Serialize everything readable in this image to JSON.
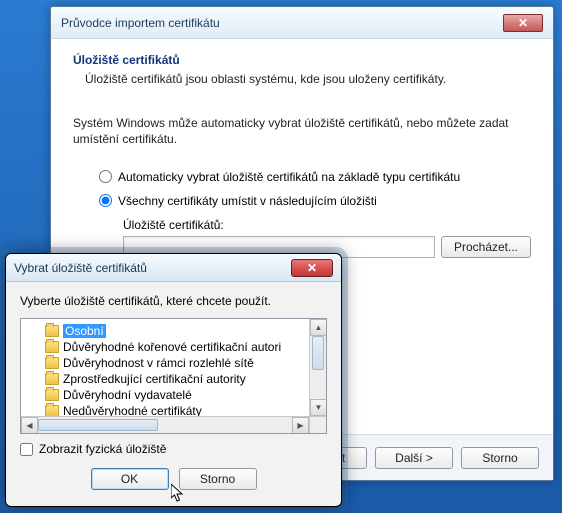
{
  "wizard": {
    "title": "Průvodce importem certifikátu",
    "section_title": "Úložiště certifikátů",
    "section_sub": "Úložiště certifikátů jsou oblasti systému, kde jsou uloženy certifikáty.",
    "instruction": "Systém Windows může automaticky vybrat úložiště certifikátů, nebo můžete zadat umístění certifikátu.",
    "radio_auto": "Automaticky vybrat úložiště certifikátů na základě typu certifikátu",
    "radio_manual": "Všechny certifikáty umístit v následujícím úložišti",
    "field_label": "Úložiště certifikátů:",
    "field_value": "",
    "browse": "Procházet...",
    "back": "< Zpět",
    "next": "Další >",
    "cancel": "Storno"
  },
  "dialog": {
    "title": "Vybrat úložiště certifikátů",
    "instruction": "Vyberte úložiště certifikátů, které chcete použít.",
    "items": {
      "0": "Osobní",
      "1": "Důvěryhodné kořenové certifikační autori",
      "2": "Důvěryhodnost v rámci rozlehlé sítě",
      "3": "Zprostředkující certifikační autority",
      "4": "Důvěryhodní vydavatelé",
      "5": "Nedůvěryhodné certifikáty"
    },
    "show_physical": "Zobrazit fyzická úložiště",
    "ok": "OK",
    "cancel": "Storno"
  }
}
